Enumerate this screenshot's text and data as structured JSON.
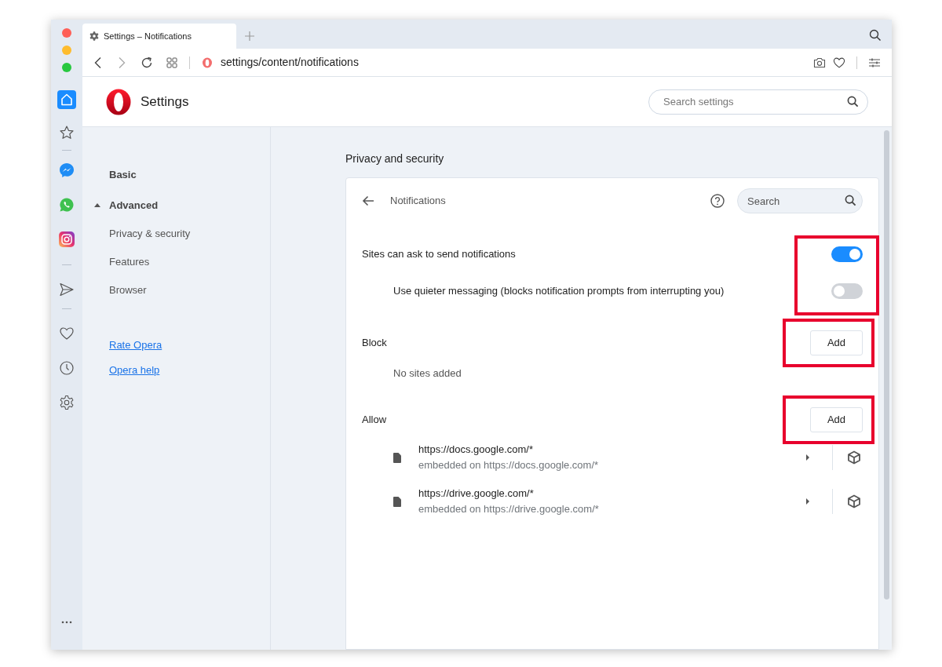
{
  "tab": {
    "title": "Settings – Notifications"
  },
  "address_bar": {
    "url": "settings/content/notifications"
  },
  "header": {
    "title": "Settings",
    "search_placeholder": "Search settings"
  },
  "nav": {
    "items": [
      {
        "label": "Basic",
        "kind": "heading",
        "expanded": false
      },
      {
        "label": "Advanced",
        "kind": "heading",
        "expanded": true
      },
      {
        "label": "Privacy & security",
        "kind": "item"
      },
      {
        "label": "Features",
        "kind": "item"
      },
      {
        "label": "Browser",
        "kind": "item"
      }
    ],
    "links": [
      "Rate Opera",
      "Opera help"
    ]
  },
  "section_title": "Privacy and security",
  "panel": {
    "title": "Notifications",
    "search_placeholder": "Search",
    "toggles_highlighted": true,
    "toggles": [
      {
        "label": "Sites can ask to send notifications",
        "on": true,
        "children": [
          {
            "label": "Use quieter messaging (blocks notification prompts from interrupting you)",
            "on": false
          }
        ]
      }
    ],
    "sections": [
      {
        "label": "Block",
        "button": "Add",
        "highlighted": true,
        "empty_text": "No sites added"
      },
      {
        "label": "Allow",
        "button": "Add",
        "highlighted": true,
        "sites": [
          {
            "url": "https://docs.google.com/*",
            "detail": "embedded on https://docs.google.com/*"
          },
          {
            "url": "https://drive.google.com/*",
            "detail": "embedded on https://drive.google.com/*"
          }
        ]
      }
    ]
  }
}
